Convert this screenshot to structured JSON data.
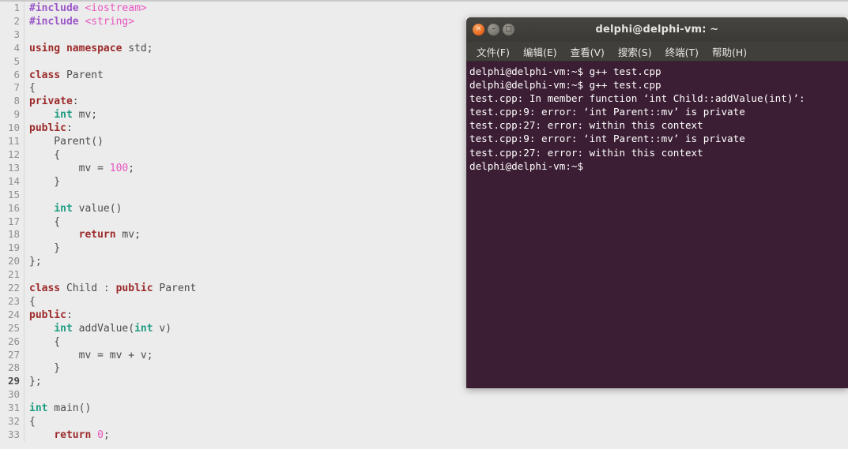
{
  "editor": {
    "name": "code-editor",
    "background": "#ececec",
    "gutter_color": "#8f8f8f",
    "current_line": 29,
    "colors": {
      "preprocessor": "#9a57c7",
      "include_path": "#e857c0",
      "keyword": "#9c2a2a",
      "type": "#1d9c82",
      "number": "#e857c0",
      "plain": "#4d4d4d"
    },
    "lines": [
      {
        "n": 1,
        "tokens": [
          {
            "t": "#include ",
            "c": "pre"
          },
          {
            "t": "<iostream>",
            "c": "inc"
          }
        ]
      },
      {
        "n": 2,
        "tokens": [
          {
            "t": "#include ",
            "c": "pre"
          },
          {
            "t": "<string>",
            "c": "inc"
          }
        ]
      },
      {
        "n": 3,
        "tokens": []
      },
      {
        "n": 4,
        "tokens": [
          {
            "t": "using namespace",
            "c": "kw"
          },
          {
            "t": " std;",
            "c": "plain"
          }
        ]
      },
      {
        "n": 5,
        "tokens": []
      },
      {
        "n": 6,
        "tokens": [
          {
            "t": "class",
            "c": "kw"
          },
          {
            "t": " Parent",
            "c": "plain"
          }
        ]
      },
      {
        "n": 7,
        "tokens": [
          {
            "t": "{",
            "c": "plain"
          }
        ]
      },
      {
        "n": 8,
        "tokens": [
          {
            "t": "private",
            "c": "kw"
          },
          {
            "t": ":",
            "c": "plain"
          }
        ]
      },
      {
        "n": 9,
        "tokens": [
          {
            "t": "    ",
            "c": "plain"
          },
          {
            "t": "int",
            "c": "type"
          },
          {
            "t": " mv;",
            "c": "plain"
          }
        ]
      },
      {
        "n": 10,
        "tokens": [
          {
            "t": "public",
            "c": "kw"
          },
          {
            "t": ":",
            "c": "plain"
          }
        ]
      },
      {
        "n": 11,
        "tokens": [
          {
            "t": "    Parent()",
            "c": "plain"
          }
        ]
      },
      {
        "n": 12,
        "tokens": [
          {
            "t": "    {",
            "c": "plain"
          }
        ]
      },
      {
        "n": 13,
        "tokens": [
          {
            "t": "        mv = ",
            "c": "plain"
          },
          {
            "t": "100",
            "c": "num"
          },
          {
            "t": ";",
            "c": "plain"
          }
        ]
      },
      {
        "n": 14,
        "tokens": [
          {
            "t": "    }",
            "c": "plain"
          }
        ]
      },
      {
        "n": 15,
        "tokens": []
      },
      {
        "n": 16,
        "tokens": [
          {
            "t": "    ",
            "c": "plain"
          },
          {
            "t": "int",
            "c": "type"
          },
          {
            "t": " value()",
            "c": "plain"
          }
        ]
      },
      {
        "n": 17,
        "tokens": [
          {
            "t": "    {",
            "c": "plain"
          }
        ]
      },
      {
        "n": 18,
        "tokens": [
          {
            "t": "        ",
            "c": "plain"
          },
          {
            "t": "return",
            "c": "kw"
          },
          {
            "t": " mv;",
            "c": "plain"
          }
        ]
      },
      {
        "n": 19,
        "tokens": [
          {
            "t": "    }",
            "c": "plain"
          }
        ]
      },
      {
        "n": 20,
        "tokens": [
          {
            "t": "};",
            "c": "plain"
          }
        ]
      },
      {
        "n": 21,
        "tokens": []
      },
      {
        "n": 22,
        "tokens": [
          {
            "t": "class",
            "c": "kw"
          },
          {
            "t": " Child : ",
            "c": "plain"
          },
          {
            "t": "public",
            "c": "kw"
          },
          {
            "t": " Parent",
            "c": "plain"
          }
        ]
      },
      {
        "n": 23,
        "tokens": [
          {
            "t": "{",
            "c": "plain"
          }
        ]
      },
      {
        "n": 24,
        "tokens": [
          {
            "t": "public",
            "c": "kw"
          },
          {
            "t": ":",
            "c": "plain"
          }
        ]
      },
      {
        "n": 25,
        "tokens": [
          {
            "t": "    ",
            "c": "plain"
          },
          {
            "t": "int",
            "c": "type"
          },
          {
            "t": " addValue(",
            "c": "plain"
          },
          {
            "t": "int",
            "c": "type"
          },
          {
            "t": " v)",
            "c": "plain"
          }
        ]
      },
      {
        "n": 26,
        "tokens": [
          {
            "t": "    {",
            "c": "plain"
          }
        ]
      },
      {
        "n": 27,
        "tokens": [
          {
            "t": "        mv = mv + v;",
            "c": "plain"
          }
        ]
      },
      {
        "n": 28,
        "tokens": [
          {
            "t": "    }",
            "c": "plain"
          }
        ]
      },
      {
        "n": 29,
        "tokens": [
          {
            "t": "};",
            "c": "plain"
          }
        ]
      },
      {
        "n": 30,
        "tokens": []
      },
      {
        "n": 31,
        "tokens": [
          {
            "t": "int",
            "c": "type"
          },
          {
            "t": " main()",
            "c": "plain"
          }
        ]
      },
      {
        "n": 32,
        "tokens": [
          {
            "t": "{",
            "c": "plain"
          }
        ]
      },
      {
        "n": 33,
        "tokens": [
          {
            "t": "    ",
            "c": "plain"
          },
          {
            "t": "return",
            "c": "kw"
          },
          {
            "t": " ",
            "c": "plain"
          },
          {
            "t": "0",
            "c": "num"
          },
          {
            "t": ";",
            "c": "plain"
          }
        ]
      }
    ]
  },
  "terminal": {
    "title": "delphi@delphi-vm: ~",
    "background": "#3c1e34",
    "titlebar_background": "#3f3d39",
    "window_buttons": [
      {
        "name": "close",
        "glyph": "✕"
      },
      {
        "name": "minimize",
        "glyph": "–"
      },
      {
        "name": "maximize",
        "glyph": "□"
      }
    ],
    "menu": [
      {
        "label": "文件(F)"
      },
      {
        "label": "编辑(E)"
      },
      {
        "label": "查看(V)"
      },
      {
        "label": "搜索(S)"
      },
      {
        "label": "终端(T)"
      },
      {
        "label": "帮助(H)"
      }
    ],
    "output_lines": [
      "delphi@delphi-vm:~$ g++ test.cpp",
      "delphi@delphi-vm:~$ g++ test.cpp",
      "test.cpp: In member function ‘int Child::addValue(int)’:",
      "test.cpp:9: error: ‘int Parent::mv’ is private",
      "test.cpp:27: error: within this context",
      "test.cpp:9: error: ‘int Parent::mv’ is private",
      "test.cpp:27: error: within this context",
      "delphi@delphi-vm:~$"
    ]
  }
}
